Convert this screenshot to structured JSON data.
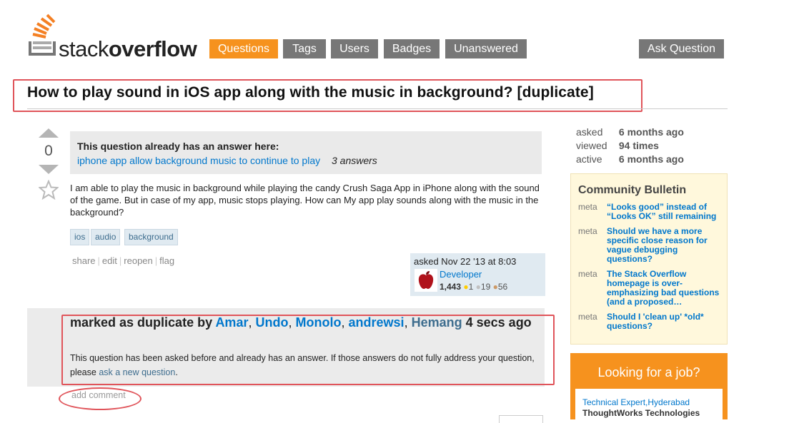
{
  "logo": {
    "text_light": "stack",
    "text_bold": "overflow",
    "icon": "stack-logo-icon",
    "accent": "#f48024"
  },
  "nav": {
    "items": [
      {
        "label": "Questions",
        "active": true
      },
      {
        "label": "Tags"
      },
      {
        "label": "Users"
      },
      {
        "label": "Badges"
      },
      {
        "label": "Unanswered"
      }
    ],
    "ask_label": "Ask Question"
  },
  "question": {
    "title": "How to play sound in iOS app along with the music in background? [duplicate]",
    "votes": "0",
    "duplicate_notice": {
      "heading": "This question already has an answer here:",
      "link": "iphone app allow background music to continue to play",
      "count": "3 answers"
    },
    "body": "I am able to play the music in background while playing the candy Crush Saga App in iPhone along with the sound of the game. But in case of my app, music stops playing. How can My app play sounds along with the music in the background?",
    "tags": [
      "ios",
      "audio",
      "background"
    ],
    "menu": [
      "share",
      "edit",
      "reopen",
      "flag"
    ],
    "asked": "asked Nov 22 '13 at 8:03",
    "user": {
      "name": "Developer",
      "reputation": "1,443",
      "gold": "1",
      "silver": "19",
      "bronze": "56"
    }
  },
  "closed": {
    "prefix": "marked as duplicate by",
    "users": [
      "Amar",
      "Undo",
      "Monolo",
      "andrewsi",
      "Hemang"
    ],
    "time": "4 secs ago",
    "text_before": "This question has been asked before and already has an answer. If those answers do not fully address your question, please",
    "link": "ask a new question",
    "text_after": "."
  },
  "add_comment": "add comment",
  "stats": {
    "asked_label": "asked",
    "asked_value": "6 months ago",
    "viewed_label": "viewed",
    "viewed_value": "94 times",
    "active_label": "active",
    "active_value": "6 months ago"
  },
  "bulletin": {
    "title": "Community Bulletin",
    "items": [
      {
        "tag": "meta",
        "text": "“Looks good” instead of “Looks OK” still remaining"
      },
      {
        "tag": "meta",
        "text": "Should we have a more specific close reason for vague debugging questions?"
      },
      {
        "tag": "meta",
        "text": "The Stack Overflow homepage is over-emphasizing bad questions (and a proposed…"
      },
      {
        "tag": "meta",
        "text": "Should I 'clean up' *old* questions?"
      }
    ]
  },
  "jobs": {
    "title": "Looking for a job?",
    "job1": "Technical Expert,Hyderabad",
    "company1": "ThoughtWorks Technologies"
  },
  "colors": {
    "badge_gold": "#fc0",
    "badge_silver": "#c0c0c0",
    "badge_bronze": "#cc9966",
    "highlight": "#e0545a"
  }
}
